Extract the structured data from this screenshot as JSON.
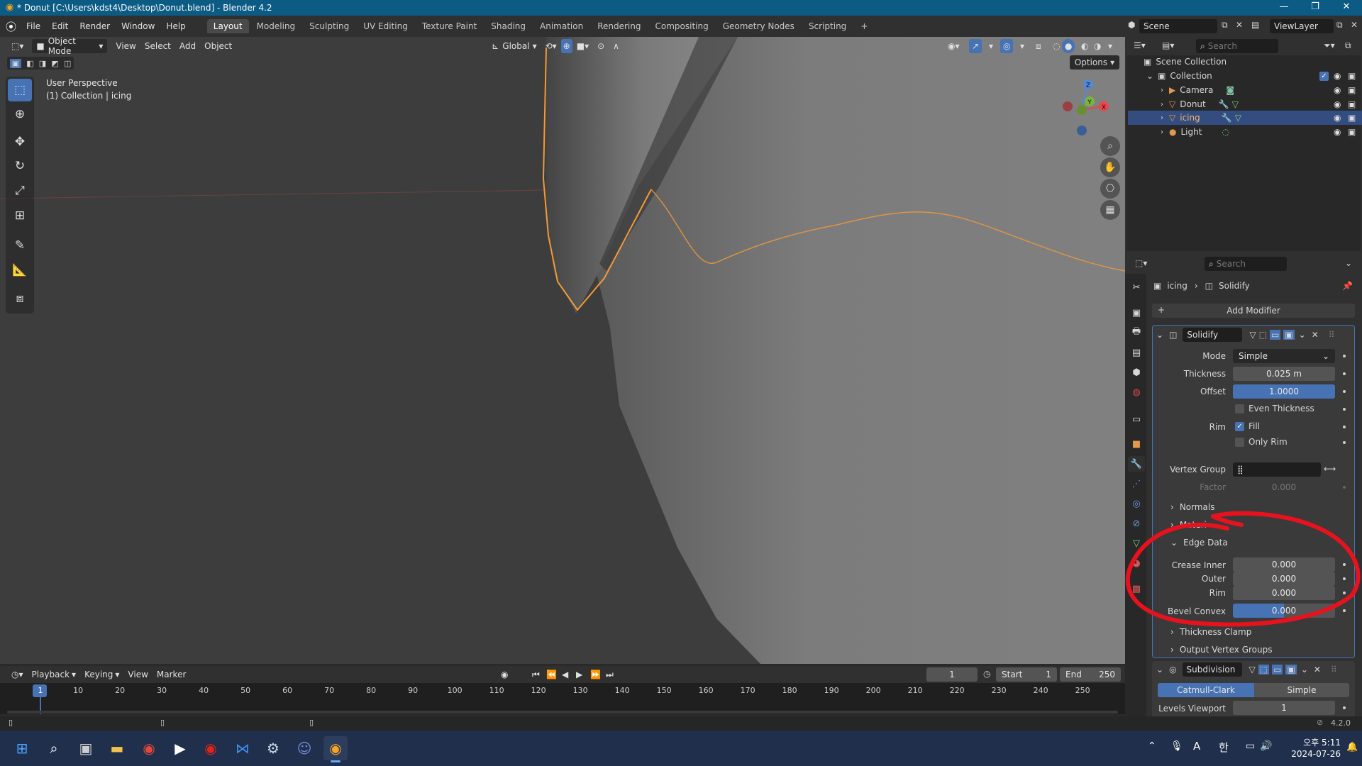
{
  "window": {
    "title": "* Donut [C:\\Users\\kdst4\\Desktop\\Donut.blend] - Blender 4.2",
    "minimize": "—",
    "restore": "❐",
    "close": "✕"
  },
  "menu": [
    "File",
    "Edit",
    "Render",
    "Window",
    "Help"
  ],
  "workspaces": [
    "Layout",
    "Modeling",
    "Sculpting",
    "UV Editing",
    "Texture Paint",
    "Shading",
    "Animation",
    "Rendering",
    "Compositing",
    "Geometry Nodes",
    "Scripting"
  ],
  "workspace_add": "+",
  "scene": {
    "scene_name": "Scene",
    "view_layer": "ViewLayer"
  },
  "viewport": {
    "mode": "Object Mode",
    "header_menu": [
      "View",
      "Select",
      "Add",
      "Object"
    ],
    "orientation": "Global",
    "options": "Options",
    "overlay_line1": "User Perspective",
    "overlay_line2": "(1) Collection | icing",
    "gizmo": {
      "x": "X",
      "y": "Y",
      "z": "Z"
    }
  },
  "outliner": {
    "search_placeholder": "Search",
    "scene_collection": "Scene Collection",
    "collection": "Collection",
    "items": [
      {
        "name": "Camera"
      },
      {
        "name": "Donut"
      },
      {
        "name": "icing"
      },
      {
        "name": "Light"
      }
    ]
  },
  "properties": {
    "search_placeholder": "Search",
    "breadcrumb_object": "icing",
    "breadcrumb_modifier": "Solidify",
    "add_modifier": "Add Modifier",
    "solidify": {
      "name": "Solidify",
      "mode_label": "Mode",
      "mode_value": "Simple",
      "thickness_label": "Thickness",
      "thickness_value": "0.025 m",
      "offset_label": "Offset",
      "offset_value": "1.0000",
      "even_thickness": "Even Thickness",
      "rim_label": "Rim",
      "fill": "Fill",
      "only_rim": "Only Rim",
      "vertex_group_label": "Vertex Group",
      "factor_label": "Factor",
      "factor_value": "0.000",
      "normals": "Normals",
      "materials": "Materi",
      "edge_data": "Edge Data",
      "crease_inner_label": "Crease Inner",
      "crease_inner_value": "0.000",
      "outer_label": "Outer",
      "outer_value": "0.000",
      "rim_crease_label": "Rim",
      "rim_crease_value": "0.000",
      "bevel_convex_label": "Bevel Convex",
      "bevel_convex_value": "0.000",
      "thickness_clamp": "Thickness Clamp",
      "output_vertex_groups": "Output Vertex Groups"
    },
    "subdivision": {
      "name": "Subdivision",
      "catmull": "Catmull-Clark",
      "simple": "Simple",
      "levels_label": "Levels Viewport",
      "levels_value": "1"
    }
  },
  "timeline": {
    "menu": [
      "Playback",
      "Keying",
      "View",
      "Marker"
    ],
    "current_frame": "1",
    "start_label": "Start",
    "start_value": "1",
    "end_label": "End",
    "end_value": "250",
    "ticks": [
      "1",
      "10",
      "20",
      "30",
      "40",
      "50",
      "60",
      "70",
      "80",
      "90",
      "100",
      "110",
      "120",
      "130",
      "140",
      "150",
      "160",
      "170",
      "180",
      "190",
      "200",
      "210",
      "220",
      "230",
      "240",
      "250"
    ]
  },
  "statusbar": {
    "version": "4.2.0"
  },
  "taskbar": {
    "time": "오후 5:11",
    "date": "2024-07-26",
    "ime_mode": "A",
    "ime_lang": "한"
  },
  "colors": {
    "accent_blue": "#4772b3",
    "selection_orange": "#f29b38",
    "annotation_red": "#e8121e",
    "title_bar": "#0c5b84",
    "taskbar": "#202f4b"
  }
}
